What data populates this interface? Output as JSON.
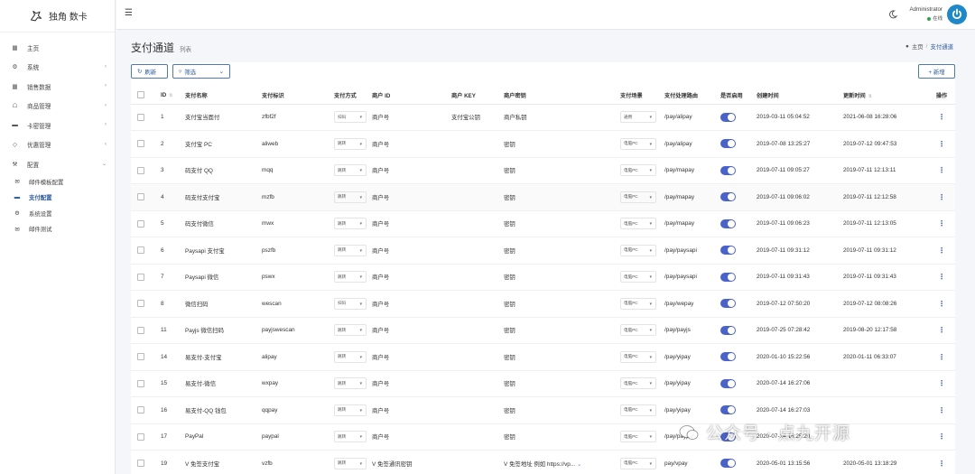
{
  "brand": {
    "name": "独角 数卡"
  },
  "sidebar": {
    "items": [
      {
        "label": "主页",
        "icon": "dashboard-icon",
        "has_chevron": false
      },
      {
        "label": "系统",
        "icon": "gear-icon",
        "has_chevron": true
      },
      {
        "label": "销售数据",
        "icon": "table-icon",
        "has_chevron": true
      },
      {
        "label": "商品管理",
        "icon": "shop-icon",
        "has_chevron": true
      },
      {
        "label": "卡密管理",
        "icon": "card-icon",
        "has_chevron": true
      },
      {
        "label": "优惠管理",
        "icon": "diamond-icon",
        "has_chevron": true
      },
      {
        "label": "配置",
        "icon": "wrench-icon",
        "has_chevron": true
      }
    ],
    "sub_items": [
      {
        "label": "邮件模板配置",
        "icon": "envelope-icon",
        "active": false
      },
      {
        "label": "支付配置",
        "icon": "payment-icon",
        "active": true
      },
      {
        "label": "系统设置",
        "icon": "cogs-icon",
        "active": false
      },
      {
        "label": "邮件测试",
        "icon": "envelope-icon",
        "active": false
      }
    ]
  },
  "topbar": {
    "user_name": "Administrator",
    "user_status": "在线"
  },
  "page": {
    "title": "支付通道",
    "subtitle": "列表",
    "breadcrumb": [
      "主页",
      "支付通道"
    ]
  },
  "toolbar": {
    "refresh_label": "刷新",
    "filter_label": "筛选",
    "add_label": "+ 新增"
  },
  "table": {
    "columns": [
      "ID",
      "支付名称",
      "支付标识",
      "支付方式",
      "商户 ID",
      "商户 KEY",
      "商户密钥",
      "支付场景",
      "支付处理路由",
      "是否启用",
      "创建时间",
      "更新时间",
      "操作"
    ],
    "rows": [
      {
        "id": "1",
        "name": "支付宝当面付",
        "code": "zfbf2f",
        "method": "扫码",
        "merchant_id": "商户号",
        "merchant_key": "支付宝公钥",
        "secret": "商户私钥",
        "scene": "通用",
        "route": "/pay/alipay",
        "created": "2019-03-11 05:04:52",
        "updated": "2021-06-08 16:28:06"
      },
      {
        "id": "2",
        "name": "支付宝 PC",
        "code": "aliweb",
        "method": "跳转",
        "merchant_id": "商户号",
        "merchant_key": "",
        "secret": "密钥",
        "scene": "电脑PC",
        "route": "/pay/alipay",
        "created": "2019-07-08 13:25:27",
        "updated": "2019-07-12 09:47:53"
      },
      {
        "id": "3",
        "name": "码支付 QQ",
        "code": "mqq",
        "method": "跳转",
        "merchant_id": "商户号",
        "merchant_key": "",
        "secret": "密钥",
        "scene": "电脑PC",
        "route": "/pay/mapay",
        "created": "2019-07-11 09:05:27",
        "updated": "2019-07-11 12:13:11"
      },
      {
        "id": "4",
        "name": "码支付支付宝",
        "code": "mzfb",
        "method": "跳转",
        "merchant_id": "商户号",
        "merchant_key": "",
        "secret": "密钥",
        "scene": "电脑PC",
        "route": "/pay/mapay",
        "created": "2019-07-11 09:06:02",
        "updated": "2019-07-11 12:12:58"
      },
      {
        "id": "5",
        "name": "码支付微信",
        "code": "mwx",
        "method": "跳转",
        "merchant_id": "商户号",
        "merchant_key": "",
        "secret": "密钥",
        "scene": "电脑PC",
        "route": "/pay/mapay",
        "created": "2019-07-11 09:06:23",
        "updated": "2019-07-11 12:13:05"
      },
      {
        "id": "6",
        "name": "Paysapi 支付宝",
        "code": "pszfb",
        "method": "跳转",
        "merchant_id": "商户号",
        "merchant_key": "",
        "secret": "密钥",
        "scene": "电脑PC",
        "route": "/pay/paysapi",
        "created": "2019-07-11 09:31:12",
        "updated": "2019-07-11 09:31:12"
      },
      {
        "id": "7",
        "name": "Paysapi 微信",
        "code": "pswx",
        "method": "跳转",
        "merchant_id": "商户号",
        "merchant_key": "",
        "secret": "密钥",
        "scene": "电脑PC",
        "route": "/pay/paysapi",
        "created": "2019-07-11 09:31:43",
        "updated": "2019-07-11 09:31:43"
      },
      {
        "id": "8",
        "name": "微信扫码",
        "code": "wescan",
        "method": "扫码",
        "merchant_id": "商户号",
        "merchant_key": "",
        "secret": "密钥",
        "scene": "电脑PC",
        "route": "/pay/wepay",
        "created": "2019-07-12 07:50:20",
        "updated": "2019-07-12 08:08:26"
      },
      {
        "id": "11",
        "name": "Payjs 微信扫码",
        "code": "payjswescan",
        "method": "跳转",
        "merchant_id": "商户号",
        "merchant_key": "",
        "secret": "密钥",
        "scene": "电脑PC",
        "route": "/pay/payjs",
        "created": "2019-07-25 07:28:42",
        "updated": "2019-08-20 12:17:58"
      },
      {
        "id": "14",
        "name": "易支付-支付宝",
        "code": "alipay",
        "method": "跳转",
        "merchant_id": "商户号",
        "merchant_key": "",
        "secret": "密钥",
        "scene": "电脑PC",
        "route": "/pay/yipay",
        "created": "2020-01-10 15:22:56",
        "updated": "2020-01-11 06:33:07"
      },
      {
        "id": "15",
        "name": "易支付-微信",
        "code": "wxpay",
        "method": "跳转",
        "merchant_id": "商户号",
        "merchant_key": "",
        "secret": "密钥",
        "scene": "电脑PC",
        "route": "/pay/yipay",
        "created": "2020-07-14 16:27:06",
        "updated": ""
      },
      {
        "id": "16",
        "name": "易支付-QQ 钱包",
        "code": "qqpay",
        "method": "跳转",
        "merchant_id": "商户号",
        "merchant_key": "",
        "secret": "密钥",
        "scene": "电脑PC",
        "route": "/pay/yipay",
        "created": "2020-07-14 16:27:03",
        "updated": ""
      },
      {
        "id": "17",
        "name": "PayPal",
        "code": "paypal",
        "method": "跳转",
        "merchant_id": "商户号",
        "merchant_key": "",
        "secret": "密钥",
        "scene": "电脑PC",
        "route": "/pay/paypal",
        "created": "2020-07-14 16:25:20",
        "updated": ""
      },
      {
        "id": "19",
        "name": "V 免签支付宝",
        "code": "vzfb",
        "method": "跳转",
        "merchant_id": "V 免签通讯密钥",
        "merchant_key": "",
        "secret": "V 免签地址 例如 https://vp...",
        "scene": "电脑PC",
        "route": "pay/vpay",
        "created": "2020-05-01 13:15:56",
        "updated": "2020-05-01 13:18:29"
      }
    ]
  },
  "watermark": {
    "text": "公众号 · 点九开源"
  },
  "colors": {
    "accent": "#2c5aa0",
    "toggle": "#4a63c9",
    "status_online": "#28a745",
    "power": "#1e88c9"
  }
}
